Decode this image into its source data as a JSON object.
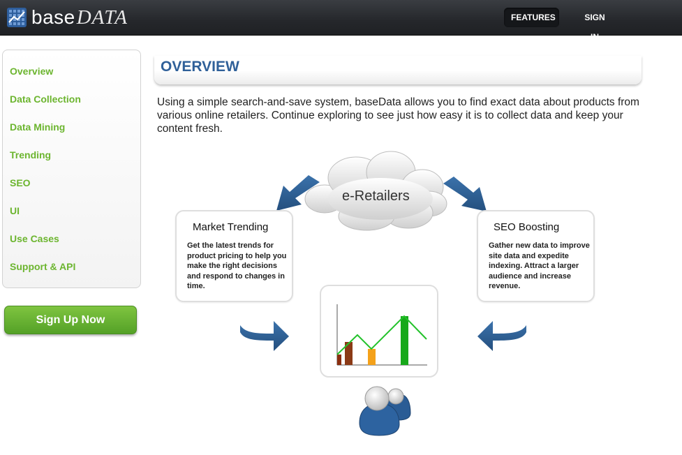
{
  "header": {
    "logo_base": "base",
    "logo_data": "DATA",
    "nav": {
      "features": "FEATURES",
      "sign_in": "SIGN IN"
    }
  },
  "sidebar": {
    "items": [
      {
        "label": "Overview"
      },
      {
        "label": "Data Collection"
      },
      {
        "label": "Data Mining"
      },
      {
        "label": "Trending"
      },
      {
        "label": "SEO"
      },
      {
        "label": "UI"
      },
      {
        "label": "Use Cases"
      },
      {
        "label": "Support & API"
      }
    ],
    "cta": "Sign Up Now"
  },
  "main": {
    "title": "OVERVIEW",
    "intro": "Using a simple search-and-save system, baseData allows you to find exact data about products from various online retailers. Continue exploring to see just how easy it is to collect data and keep your content fresh.",
    "diagram": {
      "cloud_label": "e-Retailers",
      "left_card": {
        "title": "Market Trending",
        "text": "Get the latest trends for product pricing to help you make the right decisions and respond to changes in time."
      },
      "right_card": {
        "title": "SEO Boosting",
        "text": "Gather new data to improve site data and expedite indexing. Attract a larger audience and increase revenue."
      }
    }
  },
  "colors": {
    "accent_green": "#6cb52f",
    "title_blue": "#2f6099",
    "arrow_blue": "#2d5f93"
  }
}
